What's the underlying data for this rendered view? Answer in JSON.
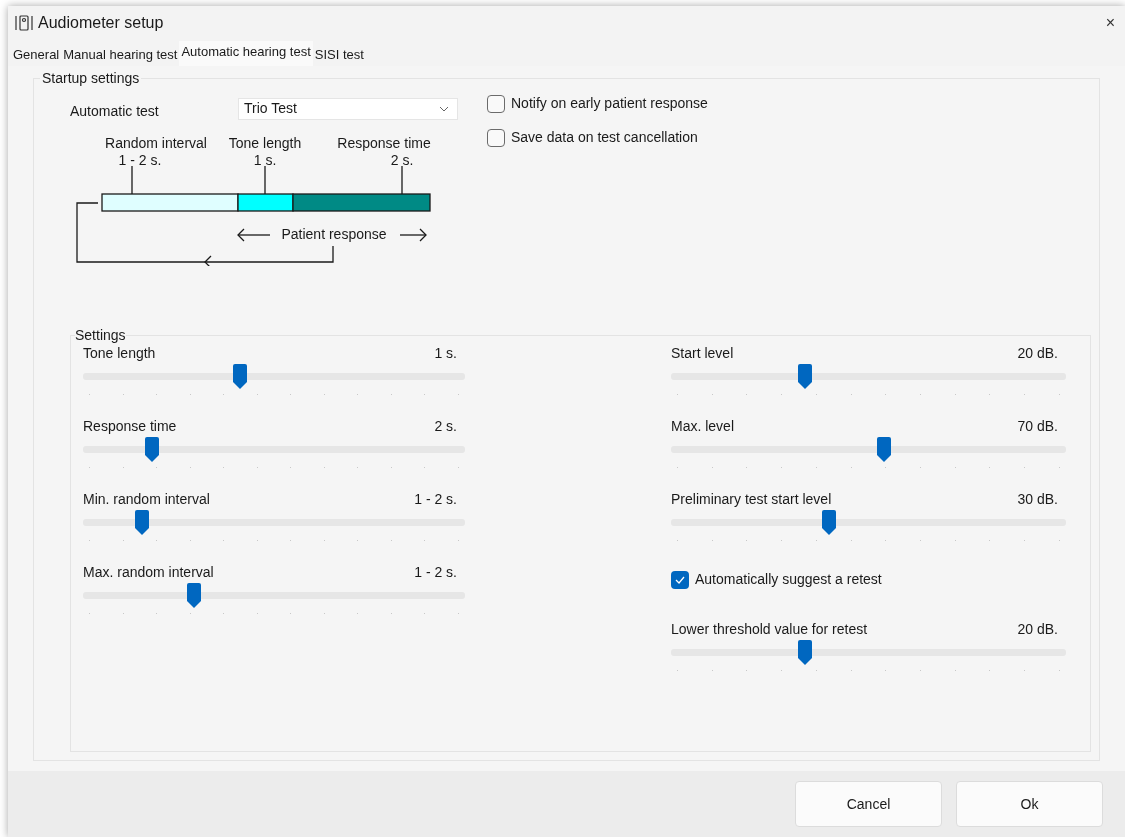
{
  "window": {
    "title": "Audiometer setup",
    "close": "×"
  },
  "tabs": [
    {
      "label": "General",
      "selected": false
    },
    {
      "label": "Manual hearing test",
      "selected": false
    },
    {
      "label": "Automatic hearing test",
      "selected": true
    },
    {
      "label": "SISI test",
      "selected": false
    }
  ],
  "startup": {
    "legend": "Startup settings",
    "test_label": "Automatic test",
    "test_value": "Trio Test",
    "options": [
      {
        "label": "Notify on early patient response",
        "checked": false
      },
      {
        "label": "Save data on test cancellation",
        "checked": false
      }
    ],
    "diagram": {
      "interval_label": "Random interval",
      "interval_value": "1 - 2 s.",
      "tone_label": "Tone length",
      "tone_value": "1 s.",
      "response_label": "Response time",
      "response_value": "2 s.",
      "patient_response": "Patient response"
    }
  },
  "settings": {
    "legend": "Settings",
    "left": [
      {
        "kind": "slider",
        "label": "Tone length",
        "reading": "1 s.",
        "level": 0.41
      },
      {
        "kind": "slider",
        "label": "Response time",
        "reading": "2 s.",
        "level": 0.18
      },
      {
        "kind": "slider",
        "label": "Min. random interval",
        "reading": "1 - 2 s.",
        "level": 0.155
      },
      {
        "kind": "slider",
        "label": "Max. random interval",
        "reading": "1 - 2 s.",
        "level": 0.29
      }
    ],
    "right": [
      {
        "kind": "slider",
        "label": "Start level",
        "reading": "20 dB.",
        "level": 0.34
      },
      {
        "kind": "slider",
        "label": "Max. level",
        "reading": "70 dB.",
        "level": 0.54
      },
      {
        "kind": "slider",
        "label": "Preliminary test start level",
        "reading": "30 dB.",
        "level": 0.4
      },
      {
        "kind": "checkbox",
        "label": "Automatically suggest a retest",
        "checked": true
      },
      {
        "kind": "slider",
        "label": "Lower threshold value for retest",
        "reading": "20 dB.",
        "level": 0.34
      }
    ]
  },
  "buttons": [
    {
      "label": "Cancel"
    },
    {
      "label": "Ok"
    }
  ]
}
